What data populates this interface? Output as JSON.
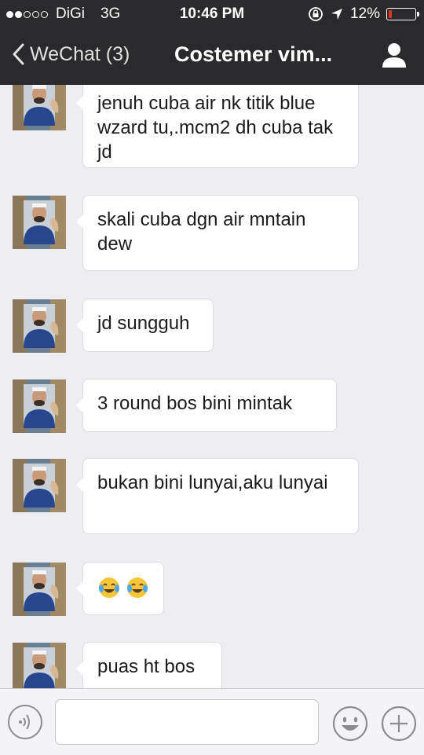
{
  "status_bar": {
    "carrier": "DiGi",
    "network": "3G",
    "signal_bars_filled": 2,
    "signal_bars_total": 5,
    "time": "10:46 PM",
    "battery_percent": "12%",
    "battery_level": 0.12,
    "icons": [
      "lock-rotation-icon",
      "location-arrow-icon",
      "battery-icon"
    ]
  },
  "nav": {
    "back_label": "WeChat (3)",
    "title": "Costemer vim..."
  },
  "messages": [
    {
      "text": "jenuh cuba air nk titik blue wzard tu,.mcm2 dh cuba tak jd"
    },
    {
      "text": "skali cuba dgn air mntain dew"
    },
    {
      "text": "jd sungguh"
    },
    {
      "text": "3 round bos bini mintak"
    },
    {
      "text": "bukan bini lunyai,aku lunyai"
    },
    {
      "text": "",
      "emoji": [
        "tears-of-joy-emoji",
        "tears-of-joy-emoji"
      ]
    },
    {
      "text": "puas ht bos"
    }
  ],
  "input_bar": {
    "icons": [
      "voice-icon",
      "emoji-icon",
      "plus-icon"
    ],
    "value": ""
  },
  "colors": {
    "bar_background": "#2a2a2c",
    "chat_background": "#eeeef2",
    "bubble_background": "#ffffff",
    "battery_low": "#e2331d"
  }
}
